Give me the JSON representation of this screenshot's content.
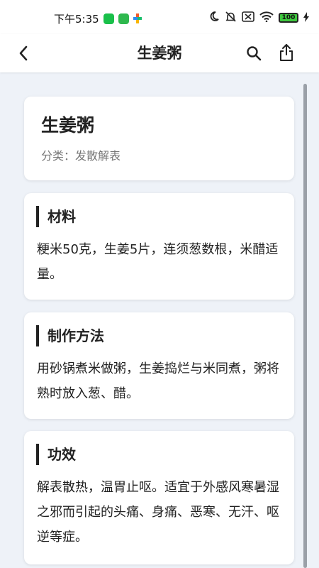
{
  "status_bar": {
    "time": "下午5:35",
    "battery": "100",
    "icons": [
      "wechat-icon",
      "green-app-icon",
      "colorful-app-icon",
      "moon-icon",
      "bell-muted-icon",
      "sim-off-icon",
      "wifi-icon",
      "battery-icon",
      "charging-icon"
    ]
  },
  "app_bar": {
    "title": "生姜粥",
    "back_icon": "chevron-left-icon",
    "search_icon": "search-icon",
    "share_icon": "share-icon"
  },
  "recipe": {
    "title": "生姜粥",
    "category": "分类：发散解表"
  },
  "sections": [
    {
      "heading": "材料",
      "body": "粳米50克，生姜5片，连须葱数根，米醋适量。"
    },
    {
      "heading": "制作方法",
      "body": "用砂锅煮米做粥，生姜捣烂与米同煮，粥将熟时放入葱、醋。"
    },
    {
      "heading": "功效",
      "body": "解表散热，温胃止呕。适宜于外感风寒暑湿之邪而引起的头痛、身痛、恶寒、无汗、呕逆等症。"
    }
  ],
  "colors": {
    "background": "#eef2f8",
    "card": "#ffffff",
    "accent_bar": "#222222",
    "muted_text": "#777777"
  }
}
